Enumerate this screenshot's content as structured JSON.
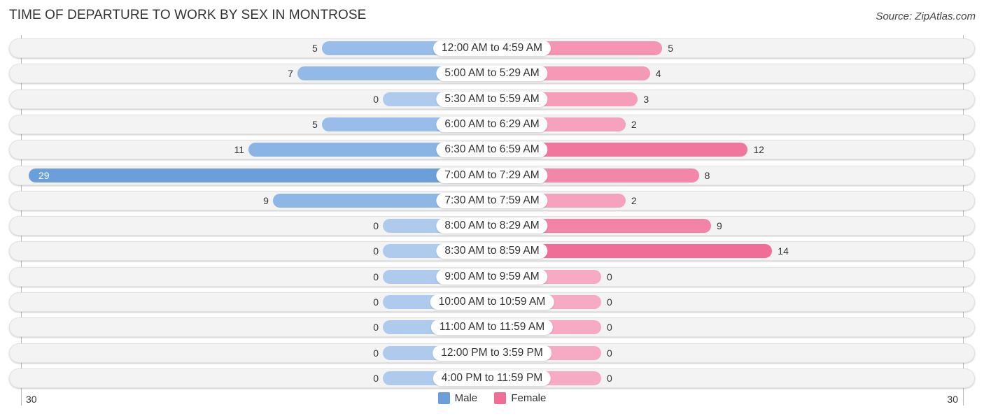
{
  "chart_data": {
    "type": "bar",
    "orientation": "horizontal-diverging",
    "title": "TIME OF DEPARTURE TO WORK BY SEX IN MONTROSE",
    "source": "Source: ZipAtlas.com",
    "categories": [
      "12:00 AM to 4:59 AM",
      "5:00 AM to 5:29 AM",
      "5:30 AM to 5:59 AM",
      "6:00 AM to 6:29 AM",
      "6:30 AM to 6:59 AM",
      "7:00 AM to 7:29 AM",
      "7:30 AM to 7:59 AM",
      "8:00 AM to 8:29 AM",
      "8:30 AM to 8:59 AM",
      "9:00 AM to 9:59 AM",
      "10:00 AM to 10:59 AM",
      "11:00 AM to 11:59 AM",
      "12:00 PM to 3:59 PM",
      "4:00 PM to 11:59 PM"
    ],
    "series": [
      {
        "name": "Male",
        "color": "#6a9fdc",
        "values": [
          5,
          7,
          0,
          5,
          11,
          29,
          9,
          0,
          0,
          0,
          0,
          0,
          0,
          0
        ]
      },
      {
        "name": "Female",
        "color": "#f06d97",
        "values": [
          5,
          4,
          3,
          2,
          12,
          8,
          2,
          9,
          14,
          0,
          0,
          0,
          0,
          0
        ]
      }
    ],
    "axis": {
      "left_tick": "30",
      "right_tick": "30",
      "range": [
        -30,
        30
      ]
    },
    "legend": {
      "position": "bottom-center",
      "entries": [
        "Male",
        "Female"
      ]
    },
    "grid": false
  }
}
